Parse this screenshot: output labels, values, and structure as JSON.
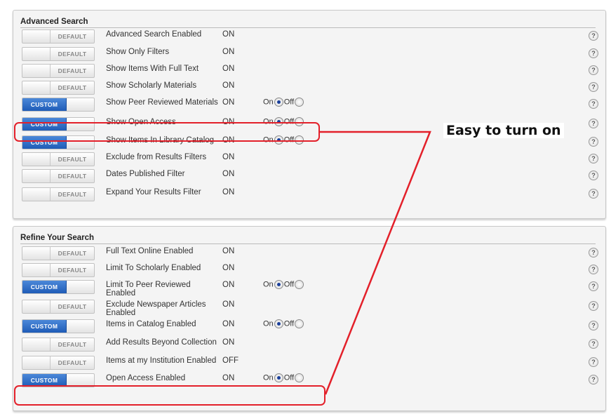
{
  "sections": [
    {
      "title": "Advanced Search",
      "rows": [
        {
          "mode": "DEFAULT",
          "label": "Advanced Search Enabled",
          "value": "ON",
          "on_off": false
        },
        {
          "mode": "DEFAULT",
          "label": "Show Only Filters",
          "value": "ON",
          "on_off": false
        },
        {
          "mode": "DEFAULT",
          "label": "Show Items With Full Text",
          "value": "ON",
          "on_off": false
        },
        {
          "mode": "DEFAULT",
          "label": "Show Scholarly Materials",
          "value": "ON",
          "on_off": false
        },
        {
          "mode": "CUSTOM",
          "label": "Show Peer Reviewed Materials",
          "value": "ON",
          "on_off": true,
          "selected": "On"
        },
        {
          "mode": "CUSTOM",
          "label": "Show Open Access",
          "value": "ON",
          "on_off": true,
          "selected": "On"
        },
        {
          "mode": "CUSTOM",
          "label": "Show Items In Library Catalog",
          "value": "ON",
          "on_off": true,
          "selected": "On"
        },
        {
          "mode": "DEFAULT",
          "label": "Exclude from Results Filters",
          "value": "ON",
          "on_off": false
        },
        {
          "mode": "DEFAULT",
          "label": "Dates Published Filter",
          "value": "ON",
          "on_off": false
        },
        {
          "mode": "DEFAULT",
          "label": "Expand Your Results Filter",
          "value": "ON",
          "on_off": false
        }
      ]
    },
    {
      "title": "Refine Your Search",
      "rows": [
        {
          "mode": "DEFAULT",
          "label": "Full Text Online Enabled",
          "value": "ON",
          "on_off": false
        },
        {
          "mode": "DEFAULT",
          "label": "Limit To Scholarly Enabled",
          "value": "ON",
          "on_off": false
        },
        {
          "mode": "CUSTOM",
          "label": "Limit To Peer Reviewed Enabled",
          "value": "ON",
          "on_off": true,
          "selected": "On"
        },
        {
          "mode": "DEFAULT",
          "label": "Exclude Newspaper Articles Enabled",
          "value": "ON",
          "on_off": false
        },
        {
          "mode": "CUSTOM",
          "label": "Items in Catalog Enabled",
          "value": "ON",
          "on_off": true,
          "selected": "On"
        },
        {
          "mode": "DEFAULT",
          "label": "Add Results Beyond Collection",
          "value": "ON",
          "on_off": false
        },
        {
          "mode": "DEFAULT",
          "label": "Items at my Institution Enabled",
          "value": "OFF",
          "on_off": false
        },
        {
          "mode": "CUSTOM",
          "label": "Open Access Enabled",
          "value": "ON",
          "on_off": true,
          "selected": "On"
        }
      ]
    }
  ],
  "radio_labels": {
    "on": "On",
    "off": "Off"
  },
  "help_glyph": "?",
  "annotation": {
    "text": "Easy to turn on",
    "color": "#e3202a"
  },
  "icons": {
    "help": "help-icon",
    "radio": "radio-button"
  }
}
